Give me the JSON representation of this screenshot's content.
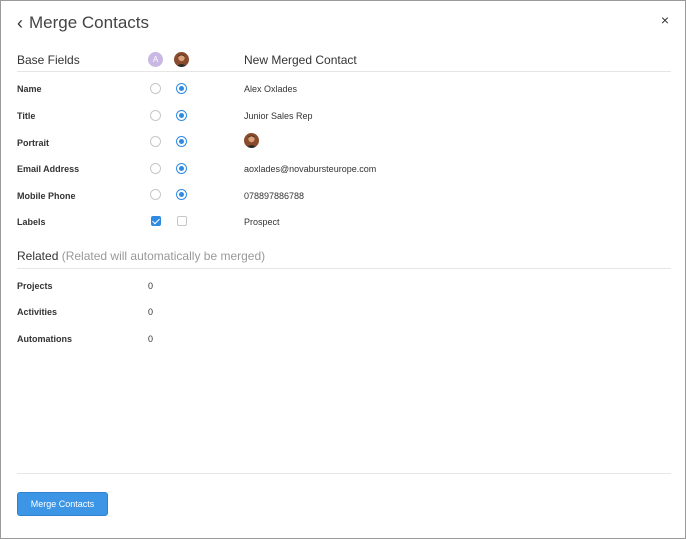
{
  "header": {
    "title": "Merge Contacts",
    "close_glyph": "×",
    "back_glyph": "‹"
  },
  "base_fields": {
    "title": "Base Fields",
    "contact_a_initial": "A",
    "merged_title": "New Merged Contact"
  },
  "fields": [
    {
      "label": "Name",
      "value": "Alex Oxlades",
      "selected": "b"
    },
    {
      "label": "Title",
      "value": "Junior Sales Rep",
      "selected": "b"
    },
    {
      "label": "Portrait",
      "value": "",
      "selected": "b"
    },
    {
      "label": "Email Address",
      "value": "aoxlades@novabursteurope.com",
      "selected": "b"
    },
    {
      "label": "Mobile Phone",
      "value": "078897886788",
      "selected": "b"
    },
    {
      "label": "Labels",
      "value": "Prospect",
      "checkbox_a": true,
      "checkbox_b": false
    }
  ],
  "related": {
    "title": "Related",
    "subtitle": "(Related will automatically be merged)",
    "items": [
      {
        "label": "Projects",
        "value": "0"
      },
      {
        "label": "Activities",
        "value": "0"
      },
      {
        "label": "Automations",
        "value": "0"
      }
    ]
  },
  "footer": {
    "merge_button_label": "Merge Contacts"
  },
  "colors": {
    "accent": "#2f8be0",
    "button": "#3d95e6",
    "avatar_a": "#c9b8e3"
  }
}
